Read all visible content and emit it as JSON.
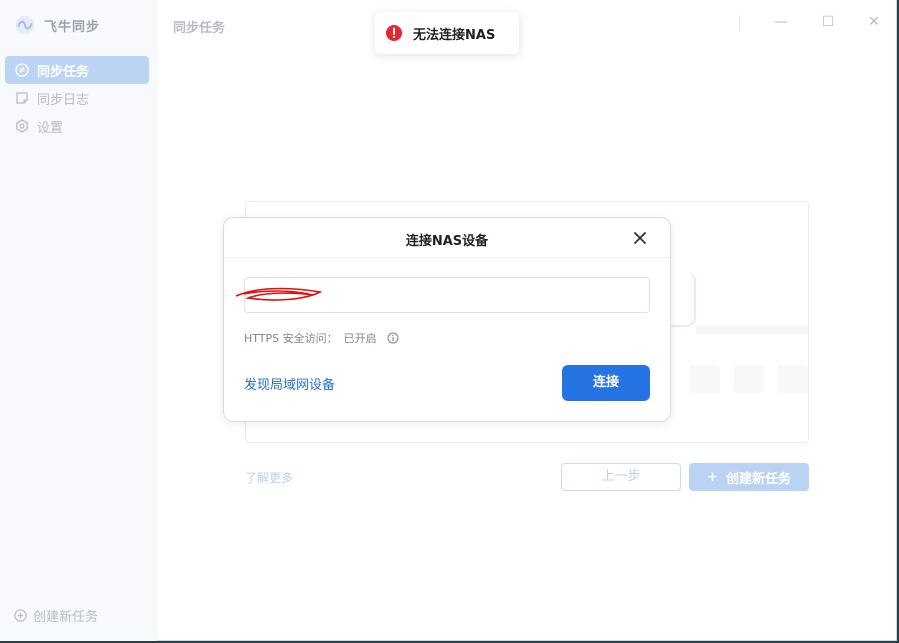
{
  "app": {
    "name": "飞牛同步",
    "page_title": "同步任务"
  },
  "sidebar": {
    "items": [
      {
        "label": "同步任务",
        "icon": "sync-icon",
        "active": true
      },
      {
        "label": "同步日志",
        "icon": "log-icon",
        "active": false
      },
      {
        "label": "设置",
        "icon": "gear-icon",
        "active": false
      }
    ],
    "bottom_label": "创建新任务"
  },
  "window_controls": {
    "minimize": "—",
    "maximize": "☐",
    "close": "✕"
  },
  "background": {
    "learn_more": "了解更多",
    "prev_button": "上一步",
    "create_button": "创建新任务",
    "create_plus": "+"
  },
  "dialog": {
    "title": "连接NAS设备",
    "host_value": "",
    "https_label": "HTTPS 安全访问：",
    "https_status": "已开启",
    "discover_link": "发现局域网设备",
    "connect_button": "连接"
  },
  "toast": {
    "message": "无法连接NAS",
    "icon": "error-icon"
  },
  "colors": {
    "accent": "#2674e3",
    "error": "#e5262e",
    "sidebar_active": "#bcd4f3"
  }
}
